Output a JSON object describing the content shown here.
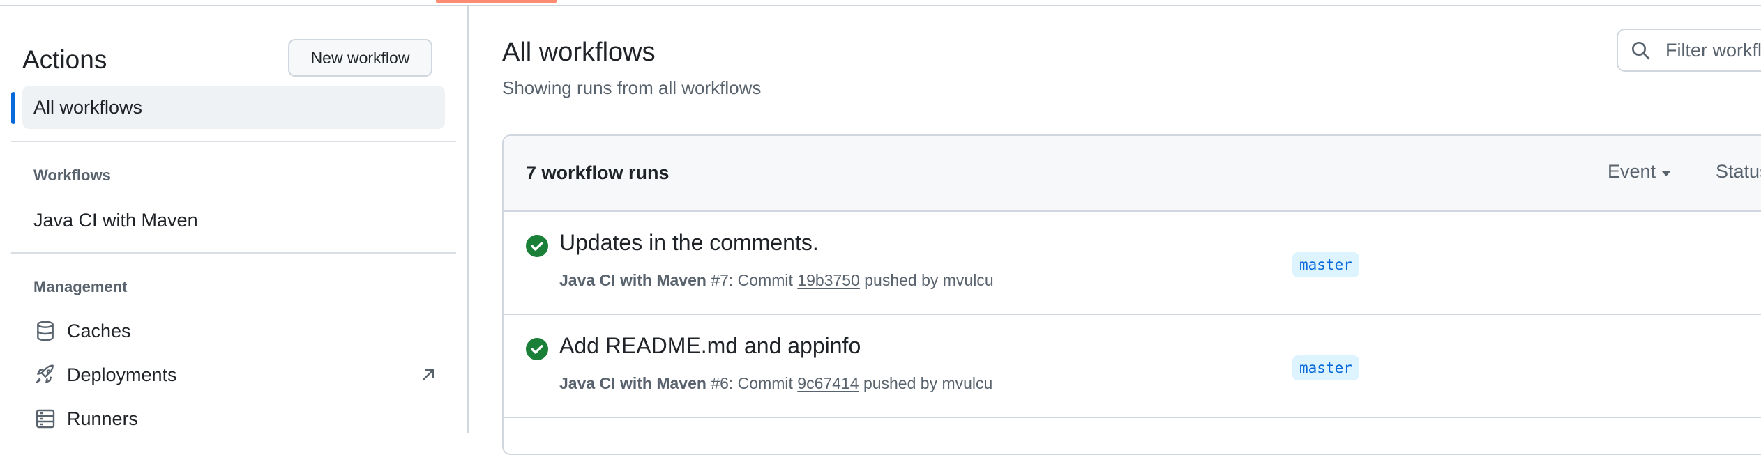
{
  "sidebar": {
    "title": "Actions",
    "new_workflow_label": "New workflow",
    "all_workflows_label": "All workflows",
    "workflows_heading": "Workflows",
    "workflows": [
      {
        "label": "Java CI with Maven"
      }
    ],
    "management_heading": "Management",
    "management_items": [
      {
        "label": "Caches",
        "icon": "database-icon"
      },
      {
        "label": "Deployments",
        "icon": "rocket-icon",
        "external": true
      },
      {
        "label": "Runners",
        "icon": "server-icon"
      }
    ]
  },
  "main": {
    "title": "All workflows",
    "subtitle": "Showing runs from all workflows",
    "filter_placeholder": "Filter workflow runs",
    "runs_count_label": "7 workflow runs",
    "header_filters": [
      {
        "label": "Event"
      },
      {
        "label": "Status"
      }
    ],
    "runs": [
      {
        "title": "Updates in the comments.",
        "workflow": "Java CI with Maven",
        "run_number": "#7",
        "commit_prefix": ": Commit",
        "sha": "19b3750",
        "pushed_by": "pushed by mvulcu",
        "branch": "master",
        "status": "success"
      },
      {
        "title": "Add README.md and appinfo",
        "workflow": "Java CI with Maven",
        "run_number": "#6",
        "commit_prefix": ": Commit",
        "sha": "9c67414",
        "pushed_by": "pushed by mvulcu",
        "branch": "master",
        "status": "success"
      }
    ]
  },
  "colors": {
    "accent": "#0969da",
    "success": "#1a7f37",
    "tab_underline": "#fd8c73",
    "branch_bg": "#ddf4ff"
  }
}
